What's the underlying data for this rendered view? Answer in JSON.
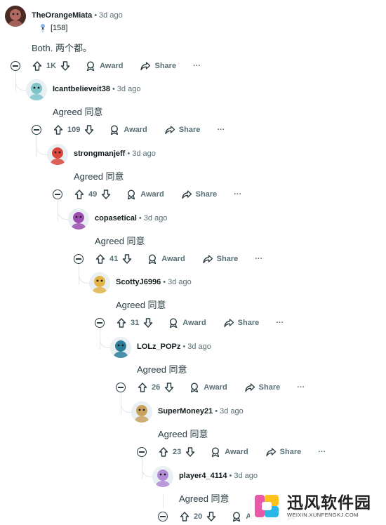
{
  "comments": [
    {
      "author": "TheOrangeMiata",
      "time": "3d ago",
      "flair": "[158]",
      "flair_icon": "gem-icon",
      "text": "Both.  两个都。",
      "votes": "1K",
      "avatar_color": "#b26b63"
    },
    {
      "author": "Icantbelieveit38",
      "time": "3d ago",
      "text": "Agreed   同意",
      "votes": "109",
      "avatar_color": "#7fc4c9"
    },
    {
      "author": "strongmanjeff",
      "time": "3d ago",
      "text": "Agreed   同意",
      "votes": "49",
      "avatar_color": "#d9483b"
    },
    {
      "author": "copasetical",
      "time": "3d ago",
      "text": "Agreed   同意",
      "votes": "41",
      "avatar_color": "#9c4fb0"
    },
    {
      "author": "ScottyJ6996",
      "time": "3d ago",
      "text": "Agreed   同意",
      "votes": "31",
      "avatar_color": "#e2b446"
    },
    {
      "author": "LOLz_POPz",
      "time": "3d ago",
      "text": "Agreed   同意",
      "votes": "26",
      "avatar_color": "#2e7e9a"
    },
    {
      "author": "SuperMoney21",
      "time": "3d ago",
      "text": "Agreed   同意",
      "votes": "23",
      "avatar_color": "#c9a25d"
    },
    {
      "author": "player4_4114",
      "time": "3d ago",
      "text": "Agreed   同意",
      "votes": "20",
      "avatar_color": "#b38ad6"
    }
  ],
  "actions": {
    "award": "Award",
    "share": "Share",
    "more": "···"
  },
  "watermark": {
    "title": "迅风软件园",
    "subtitle": "WEIXIN.XUNFENGKJ.COM"
  }
}
